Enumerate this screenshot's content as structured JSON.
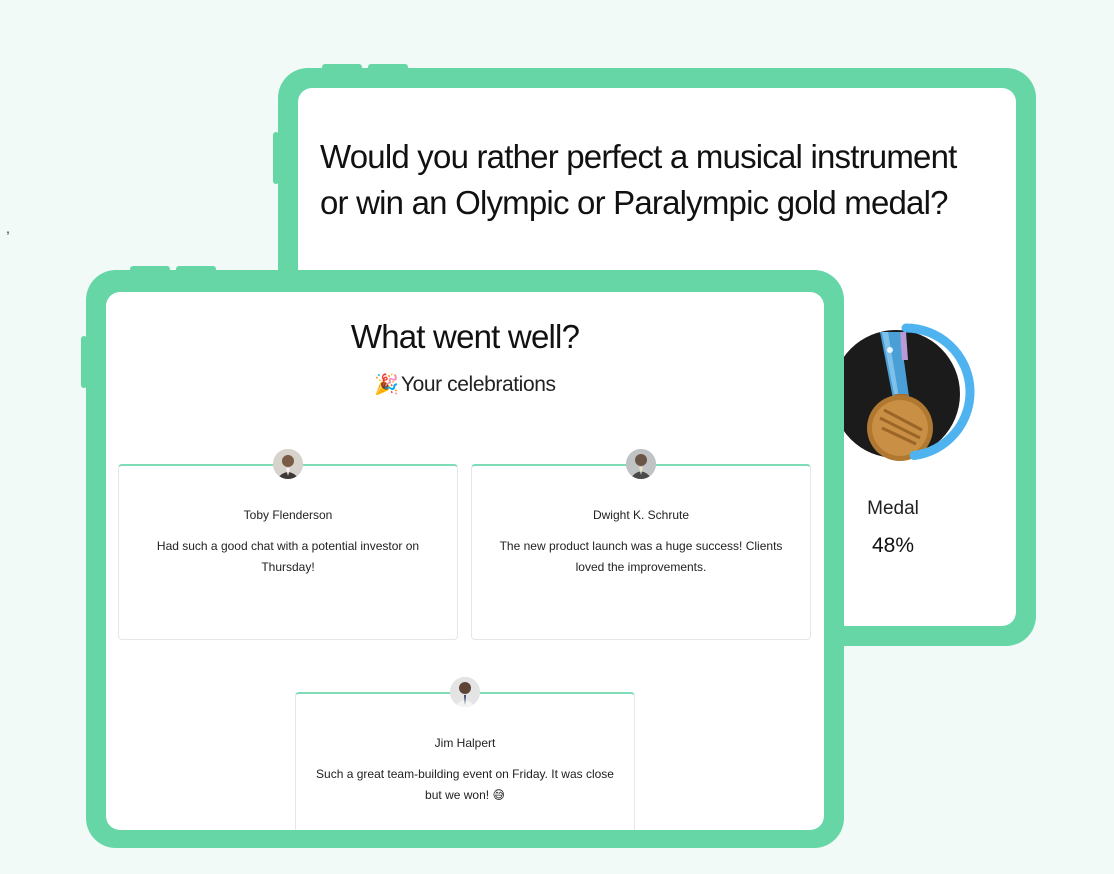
{
  "back_panel": {
    "question_line1": "Would you rather perfect a musical instrument",
    "question_line2": "or win an Olympic or Paralympic  gold medal?",
    "result": {
      "label": "Medal",
      "percent_text": "48%",
      "percent_value": 48
    }
  },
  "front_panel": {
    "title": "What went well?",
    "subtitle_icon": "🎉",
    "subtitle": "Your celebrations",
    "cards": [
      {
        "name": "Toby Flenderson",
        "message": "Had such a good chat with a potential investor on Thursday!"
      },
      {
        "name": "Dwight K. Schrute",
        "message": "The new product launch was a huge success! Clients loved the improvements."
      },
      {
        "name": "Jim Halpert",
        "message": "Such a great team-building event on Friday. It was close but we won!",
        "emoji": "😅"
      }
    ]
  },
  "colors": {
    "frame": "#66d6a7",
    "background": "#f1faf6",
    "progress_ring": "#4fb3f0",
    "card_accent": "#7fdcb6"
  },
  "icons": [
    "party-popper-icon",
    "gold-medal-icon",
    "avatar-icon"
  ]
}
